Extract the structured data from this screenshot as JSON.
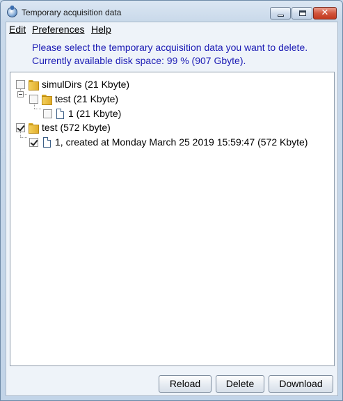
{
  "window": {
    "title": "Temporary acquisition data",
    "close_glyph": "✕"
  },
  "menu": {
    "edit": "Edit",
    "preferences": "Preferences",
    "help": "Help"
  },
  "info": {
    "line1": "Please select the temporary acquisition data you want to delete.",
    "line2": "Currently available disk space: 99 % (907 Gbyte)."
  },
  "tree": [
    {
      "label": "simulDirs (21 Kbyte)",
      "type": "folder",
      "checked": false
    },
    {
      "label": "test (21 Kbyte)",
      "type": "folder",
      "checked": false
    },
    {
      "label": "1 (21 Kbyte)",
      "type": "file",
      "checked": false
    },
    {
      "label": "test (572 Kbyte)",
      "type": "folder",
      "checked": true
    },
    {
      "label": "1, created at Monday March 25 2019 15:59:47 (572 Kbyte)",
      "type": "file",
      "checked": true
    }
  ],
  "buttons": {
    "reload": "Reload",
    "delete": "Delete",
    "download": "Download"
  },
  "colors": {
    "info_text": "#1a1ab4",
    "close_button": "#c2391e"
  }
}
